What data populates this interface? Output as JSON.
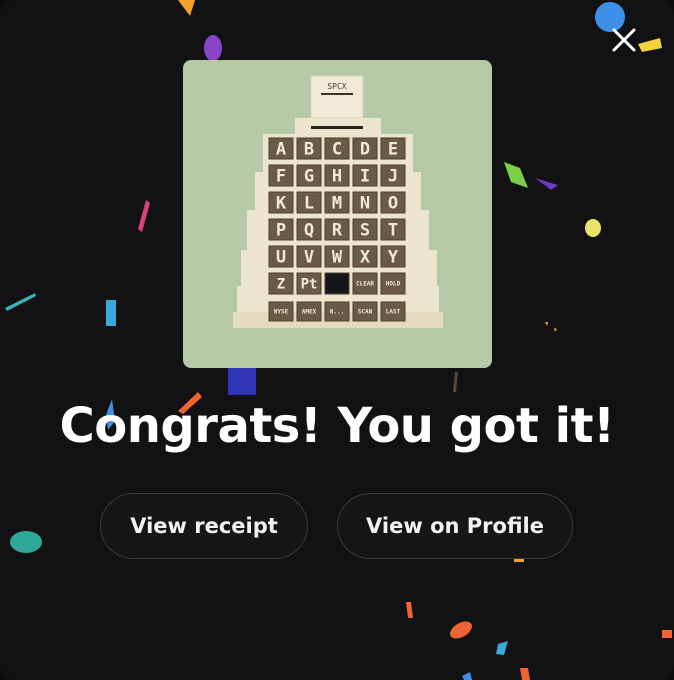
{
  "dialog": {
    "close_icon": "close-icon",
    "title": "Congrats! You got it!",
    "buttons": {
      "receipt_label": "View receipt",
      "profile_label": "View on Profile"
    }
  },
  "artwork": {
    "ticker_label": "SPCX",
    "letter_rows": [
      [
        "A",
        "B",
        "C",
        "D",
        "E"
      ],
      [
        "F",
        "G",
        "H",
        "I",
        "J"
      ],
      [
        "K",
        "L",
        "M",
        "N",
        "O"
      ],
      [
        "P",
        "Q",
        "R",
        "S",
        "T"
      ],
      [
        "U",
        "V",
        "W",
        "X",
        "Y"
      ]
    ],
    "row6": [
      "Z",
      "Pt",
      "",
      "CLEAR",
      "HOLD"
    ],
    "row7": [
      "NYSE",
      "AMEX",
      "N...",
      "SCAN",
      "LAST"
    ]
  },
  "colors": {
    "background": "#121214",
    "art_background": "#b5c9a6",
    "machine_body": "#ece4cc",
    "key_dark": "#6b5a45",
    "key_text": "#f1ead6"
  }
}
